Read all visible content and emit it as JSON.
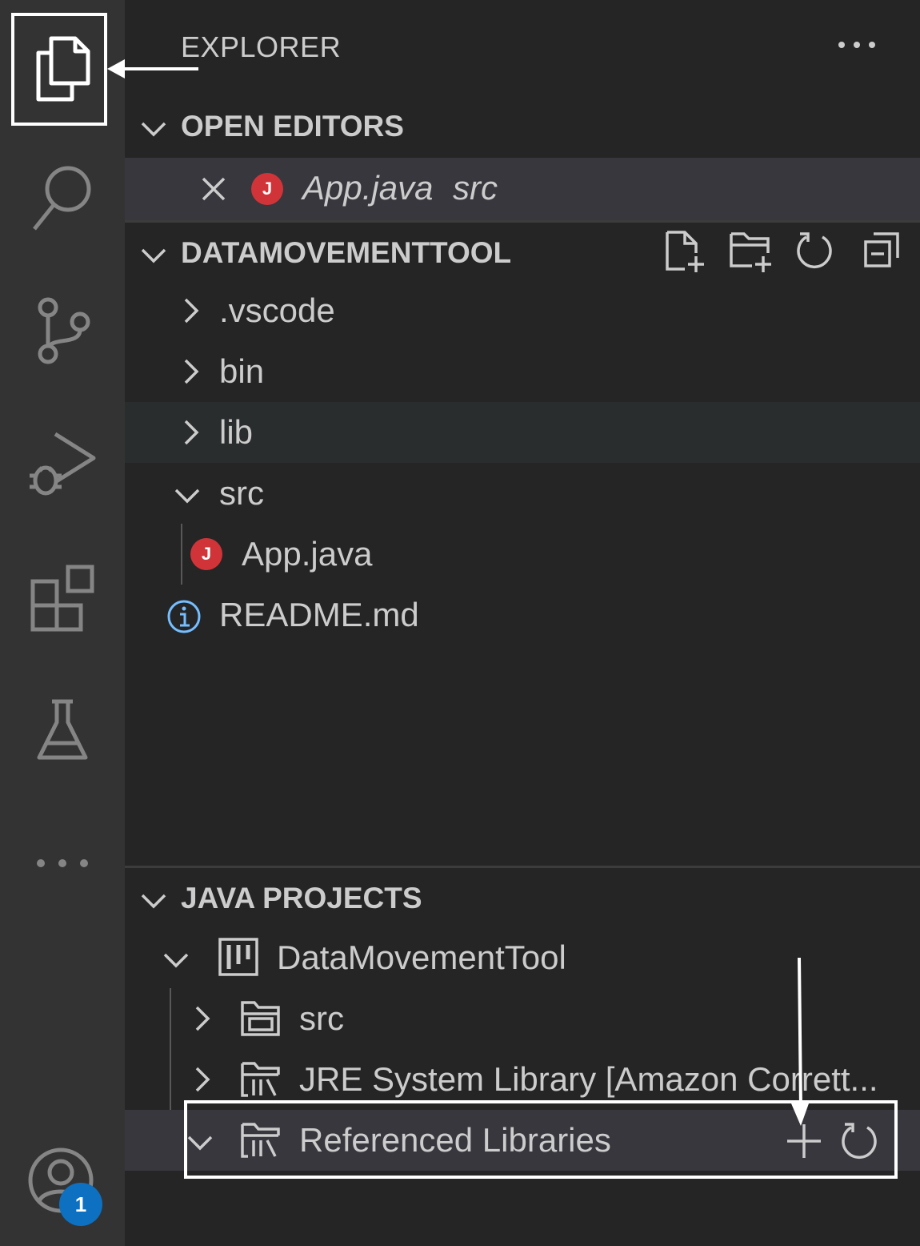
{
  "activity_bar": {
    "items": [
      {
        "icon": "files-icon",
        "active": true
      },
      {
        "icon": "search-icon"
      },
      {
        "icon": "source-control-icon"
      },
      {
        "icon": "run-debug-icon"
      },
      {
        "icon": "extensions-icon"
      },
      {
        "icon": "testing-flask-icon"
      },
      {
        "icon": "more-icon"
      }
    ],
    "accounts_badge": "1"
  },
  "explorer": {
    "title": "EXPLORER",
    "open_editors": {
      "title": "OPEN EDITORS",
      "items": [
        {
          "name": "App.java",
          "description": "src",
          "icon": "java-file-icon"
        }
      ]
    },
    "workspace": {
      "title": "DATAMOVEMENTTOOL",
      "actions": [
        "new-file-icon",
        "new-folder-icon",
        "refresh-icon",
        "collapse-all-icon"
      ],
      "tree": [
        {
          "name": ".vscode",
          "type": "folder",
          "expanded": false
        },
        {
          "name": "bin",
          "type": "folder",
          "expanded": false
        },
        {
          "name": "lib",
          "type": "folder",
          "expanded": false
        },
        {
          "name": "src",
          "type": "folder",
          "expanded": true
        },
        {
          "name": "App.java",
          "type": "file",
          "icon": "java-file-icon"
        },
        {
          "name": "README.md",
          "type": "file",
          "icon": "info-icon"
        }
      ]
    },
    "java_projects": {
      "title": "JAVA PROJECTS",
      "project": "DataMovementTool",
      "children": [
        {
          "name": "src",
          "icon": "source-folder-icon"
        },
        {
          "name": "JRE System Library [Amazon Corrett...",
          "icon": "library-icon"
        },
        {
          "name": "Referenced Libraries",
          "icon": "library-icon"
        }
      ]
    }
  },
  "colors": {
    "activity_bar": "#333333",
    "sidebar": "#252526",
    "selection": "#37373d",
    "java_badge": "#d13438",
    "account_badge": "#0e70c0"
  }
}
